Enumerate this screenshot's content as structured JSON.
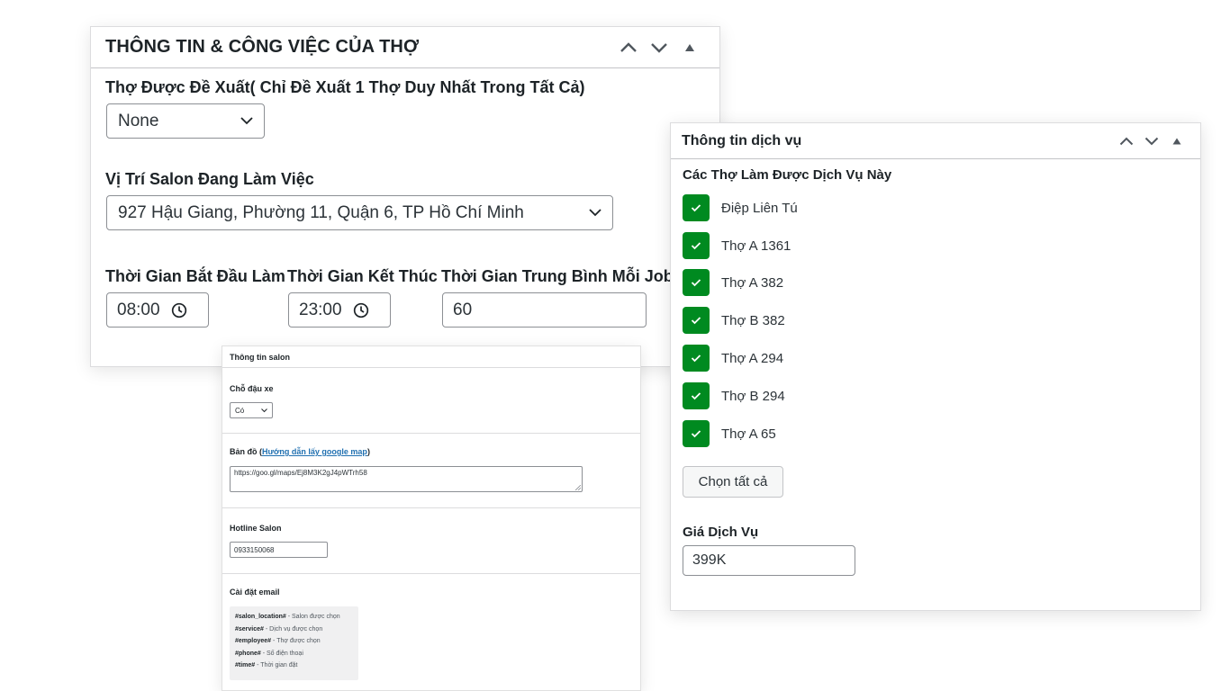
{
  "worker_panel": {
    "title": "THÔNG TIN & CÔNG VIỆC CỦA THỢ",
    "suggested_label": "Thợ Được Đề Xuất( Chỉ Đề Xuất 1 Thợ Duy Nhất Trong Tất Cả)",
    "suggested_value": "None",
    "location_label": "Vị Trí Salon Đang Làm Việc",
    "location_value": "927 Hậu Giang, Phường 11, Quận 6, TP Hồ Chí Minh",
    "start_label": "Thời Gian Bắt Đầu Làm",
    "start_value": "08:00",
    "end_label": "Thời Gian Kết Thúc",
    "end_value": "23:00",
    "avg_label": "Thời Gian Trung Bình Mỗi Job",
    "avg_value": "60"
  },
  "salon_panel": {
    "title": "Thông tin salon",
    "parking_label": "Chỗ đậu xe",
    "parking_value": "Có",
    "map_label_prefix": "Bản đồ (",
    "map_link": "Hướng dẫn lấy google map",
    "map_label_suffix": ")",
    "map_value": "https://goo.gl/maps/Ej8M3K2gJ4pWTrh58",
    "hotline_label": "Hotline Salon",
    "hotline_value": "0933150068",
    "email_label": "Cài đặt email",
    "email_vars": [
      {
        "key": "#salon_location#",
        "desc": " - Salon được chọn"
      },
      {
        "key": "#service#",
        "desc": " - Dịch vụ được chọn"
      },
      {
        "key": "#employee#",
        "desc": " - Thợ được chọn"
      },
      {
        "key": "#phone#",
        "desc": " - Số điện thoại"
      },
      {
        "key": "#time#",
        "desc": " - Thời gian đặt"
      }
    ]
  },
  "service_panel": {
    "title": "Thông tin dịch vụ",
    "workers_label": "Các Thợ Làm Được Dịch Vụ Này",
    "workers": [
      "Điệp Liên Tú",
      "Thợ A 1361",
      "Thợ A 382",
      "Thợ B 382",
      "Thợ A 294",
      "Thợ B 294",
      "Thợ A 65"
    ],
    "select_all": "Chọn tất cả",
    "price_label": "Giá Dịch Vụ",
    "price_value": "399K"
  },
  "colors": {
    "checkbox_green": "#008a20",
    "link_blue": "#2271b1"
  },
  "icons": [
    "chevron-up-icon",
    "chevron-down-icon",
    "triangle-up-icon",
    "clock-icon",
    "check-icon",
    "resize-grip-icon"
  ]
}
